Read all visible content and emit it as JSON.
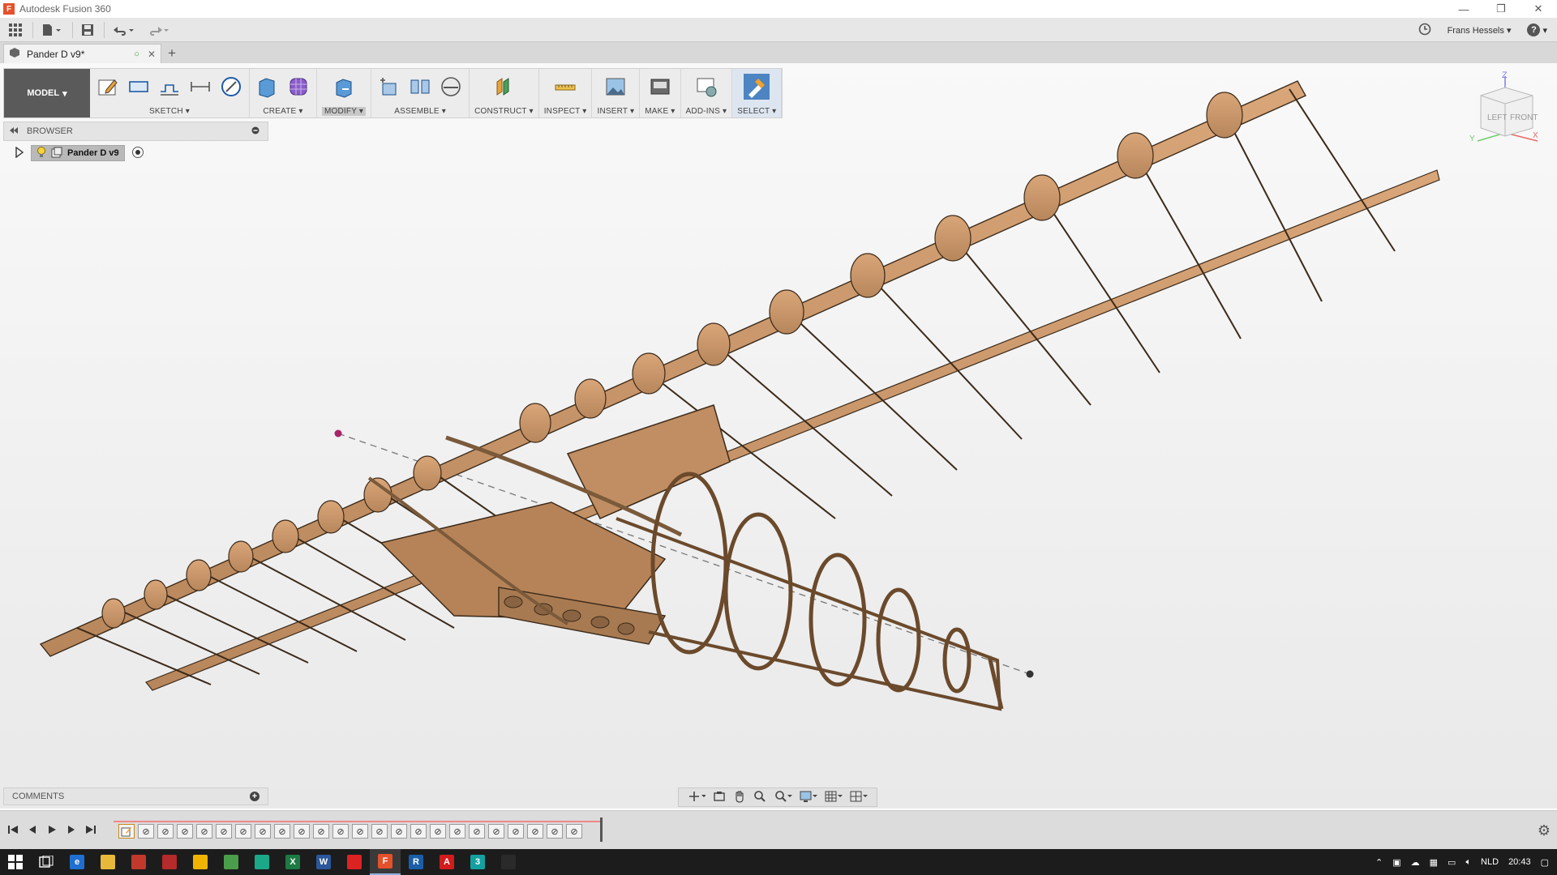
{
  "window": {
    "title": "Autodesk Fusion 360",
    "app_icon_letter": "F",
    "minimize": "—",
    "restore": "❐",
    "close": "✕"
  },
  "qat": {
    "user_name": "Frans Hessels",
    "help": "?",
    "caret": "▾"
  },
  "tabs": {
    "document_label": "Pander D v9*",
    "sync_status": "○",
    "close": "✕",
    "new_tab": "+"
  },
  "toolbar": {
    "workspace_label": "MODEL",
    "caret": "▾",
    "groups": [
      "SKETCH",
      "CREATE",
      "MODIFY",
      "ASSEMBLE",
      "CONSTRUCT",
      "INSPECT",
      "INSERT",
      "MAKE",
      "ADD-INS",
      "SELECT"
    ]
  },
  "browser": {
    "label": "BROWSER",
    "root_item": "Pander D v9"
  },
  "comments": {
    "label": "COMMENTS",
    "add": "+"
  },
  "viewcube": {
    "faces": [
      "LEFT",
      "FRONT"
    ],
    "axes": [
      "Z",
      "Y",
      "X"
    ]
  },
  "taskbar": {
    "language": "NLD",
    "time": "20:43",
    "apps": [
      {
        "name": "edge",
        "letter": "e",
        "color": "#1f6fd1"
      },
      {
        "name": "explorer",
        "letter": "",
        "color": "#e7b93a"
      },
      {
        "name": "app-red",
        "letter": "",
        "color": "#c0392b"
      },
      {
        "name": "app-red-2",
        "letter": "",
        "color": "#b52a2a"
      },
      {
        "name": "app-yellow",
        "letter": "",
        "color": "#f0b400"
      },
      {
        "name": "chrome",
        "letter": "",
        "color": "#4a9d4a"
      },
      {
        "name": "app-teal",
        "letter": "",
        "color": "#1aa889"
      },
      {
        "name": "excel",
        "letter": "X",
        "color": "#1d7a42"
      },
      {
        "name": "word",
        "letter": "W",
        "color": "#2b579a"
      },
      {
        "name": "app-red-3",
        "letter": "",
        "color": "#d22"
      },
      {
        "name": "fusion",
        "letter": "F",
        "color": "#e4512b"
      },
      {
        "name": "revit",
        "letter": "R",
        "color": "#1a5ea8"
      },
      {
        "name": "autocad",
        "letter": "A",
        "color": "#d21c1c"
      },
      {
        "name": "app-3",
        "letter": "3",
        "color": "#14a0a0"
      },
      {
        "name": "app-dark",
        "letter": "",
        "color": "#2a2a2a"
      }
    ]
  }
}
